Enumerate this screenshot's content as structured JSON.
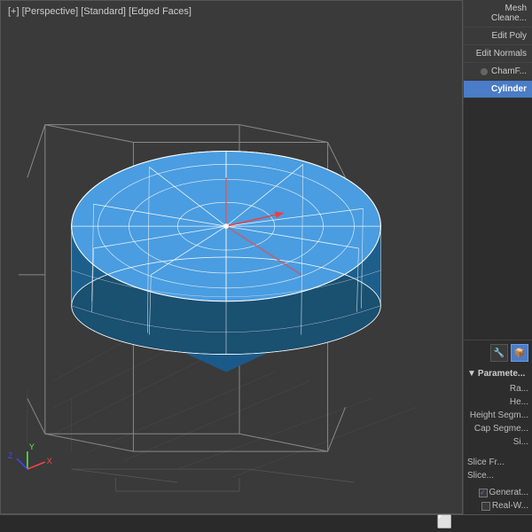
{
  "viewport": {
    "label": "[+] [Perspective] [Standard] [Edged Faces]"
  },
  "right_panel": {
    "mesh_cleaner_label": "Mesh Cleane...",
    "edit_poly_label": "Edit Poly",
    "edit_normals_label": "Edit Normals",
    "chamfer_label": "ChamF...",
    "cylinder_label": "Cylinder",
    "params_label": "Paramete...",
    "radius_label": "Ra...",
    "height_label": "He...",
    "height_seg_label": "Height Segm...",
    "cap_seg_label": "Cap Segme...",
    "sides_label": "Si...",
    "slice_from_label": "Slice Fr...",
    "slice_to_label": "Slice...",
    "generate_label": "Generat...",
    "real_world_label": "Real-W..."
  },
  "icons": {
    "pointer": "🔧",
    "modifier": "📦"
  }
}
